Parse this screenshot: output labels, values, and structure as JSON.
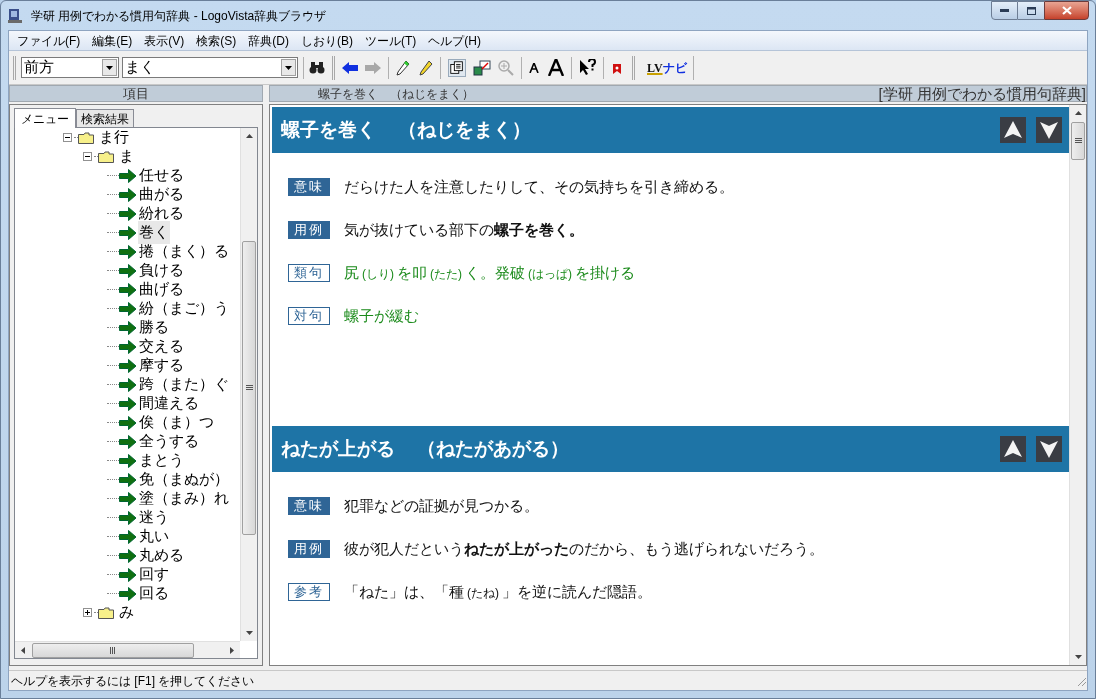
{
  "window": {
    "title": "学研 用例でわかる慣用句辞典 - LogoVista辞典ブラウザ"
  },
  "menu": [
    "ファイル(F)",
    "編集(E)",
    "表示(V)",
    "検索(S)",
    "辞典(D)",
    "しおり(B)",
    "ツール(T)",
    "ヘルプ(H)"
  ],
  "toolbar": {
    "search_mode": "前方",
    "search_value": "まく",
    "navi_button": {
      "logo": "LV",
      "label": "ナビ"
    }
  },
  "left_pane": {
    "header": "項目",
    "tabs": [
      {
        "label": "メニュー",
        "selected": true
      },
      {
        "label": "検索結果",
        "selected": false
      }
    ],
    "tree": [
      {
        "label": "ま行",
        "expanded": true,
        "children": [
          {
            "label": "ま",
            "expanded": true,
            "children": [
              {
                "label": "任せる",
                "selected": false
              },
              {
                "label": "曲がる",
                "selected": false
              },
              {
                "label": "紛れる",
                "selected": false
              },
              {
                "label": "巻く",
                "selected": true
              },
              {
                "label": "捲（まく）る",
                "selected": false
              },
              {
                "label": "負ける",
                "selected": false
              },
              {
                "label": "曲げる",
                "selected": false
              },
              {
                "label": "紛（まご）う",
                "selected": false
              },
              {
                "label": "勝る",
                "selected": false
              },
              {
                "label": "交える",
                "selected": false
              },
              {
                "label": "摩する",
                "selected": false
              },
              {
                "label": "跨（また）ぐ",
                "selected": false
              },
              {
                "label": "間違える",
                "selected": false
              },
              {
                "label": "俟（ま）つ",
                "selected": false
              },
              {
                "label": "全うする",
                "selected": false
              },
              {
                "label": "まとう",
                "selected": false
              },
              {
                "label": "免（まぬが）",
                "selected": false
              },
              {
                "label": "塗（まみ）れ",
                "selected": false
              },
              {
                "label": "迷う",
                "selected": false
              },
              {
                "label": "丸い",
                "selected": false
              },
              {
                "label": "丸める",
                "selected": false
              },
              {
                "label": "回す",
                "selected": false
              },
              {
                "label": "回る",
                "selected": false
              }
            ]
          },
          {
            "label": "み",
            "expanded": false
          }
        ]
      }
    ]
  },
  "right_pane": {
    "current": "螺子を巻く　（ねじをまく）",
    "dictionary": "[学研 用例でわかる慣用句辞典]",
    "entries": [
      {
        "title": "螺子を巻く",
        "reading": "（ねじをまく）",
        "sections": [
          {
            "kind": "definition",
            "label": "意味",
            "segments": [
              {
                "text": "だらけた人を注意したりして、その気持ちを引き締める。"
              }
            ]
          },
          {
            "kind": "definition",
            "label": "用例",
            "segments": [
              {
                "text": "気が抜けている部下の**螺子を巻く。**"
              }
            ]
          },
          {
            "kind": "related",
            "label": "類句",
            "segments": [
              {
                "text": "尻"
              },
              {
                "text": "(しり)",
                "ruby": true
              },
              {
                "text": "を叩"
              },
              {
                "text": "(たた)",
                "ruby": true
              },
              {
                "text": "く。発破"
              },
              {
                "text": "(はっぱ)",
                "ruby": true
              },
              {
                "text": "を掛ける"
              }
            ]
          },
          {
            "kind": "related",
            "label": "対句",
            "segments": [
              {
                "text": "螺子が緩む"
              }
            ]
          }
        ]
      },
      {
        "title": "ねたが上がる",
        "reading": "（ねたがあがる）",
        "sections": [
          {
            "kind": "definition",
            "label": "意味",
            "segments": [
              {
                "text": "犯罪などの証拠が見つかる。"
              }
            ]
          },
          {
            "kind": "definition",
            "label": "用例",
            "segments": [
              {
                "text": "彼が犯人だという**ねたが上がった**のだから、もう逃げられないだろう。"
              }
            ]
          },
          {
            "kind": "note",
            "label": "参考",
            "segments": [
              {
                "text": "「ねた」は、「種"
              },
              {
                "text": "(たね)",
                "ruby": true
              },
              {
                "text": "」を逆に読んだ隠語。"
              }
            ]
          }
        ]
      }
    ]
  },
  "status_bar": "ヘルプを表示するには [F1] を押してください"
}
